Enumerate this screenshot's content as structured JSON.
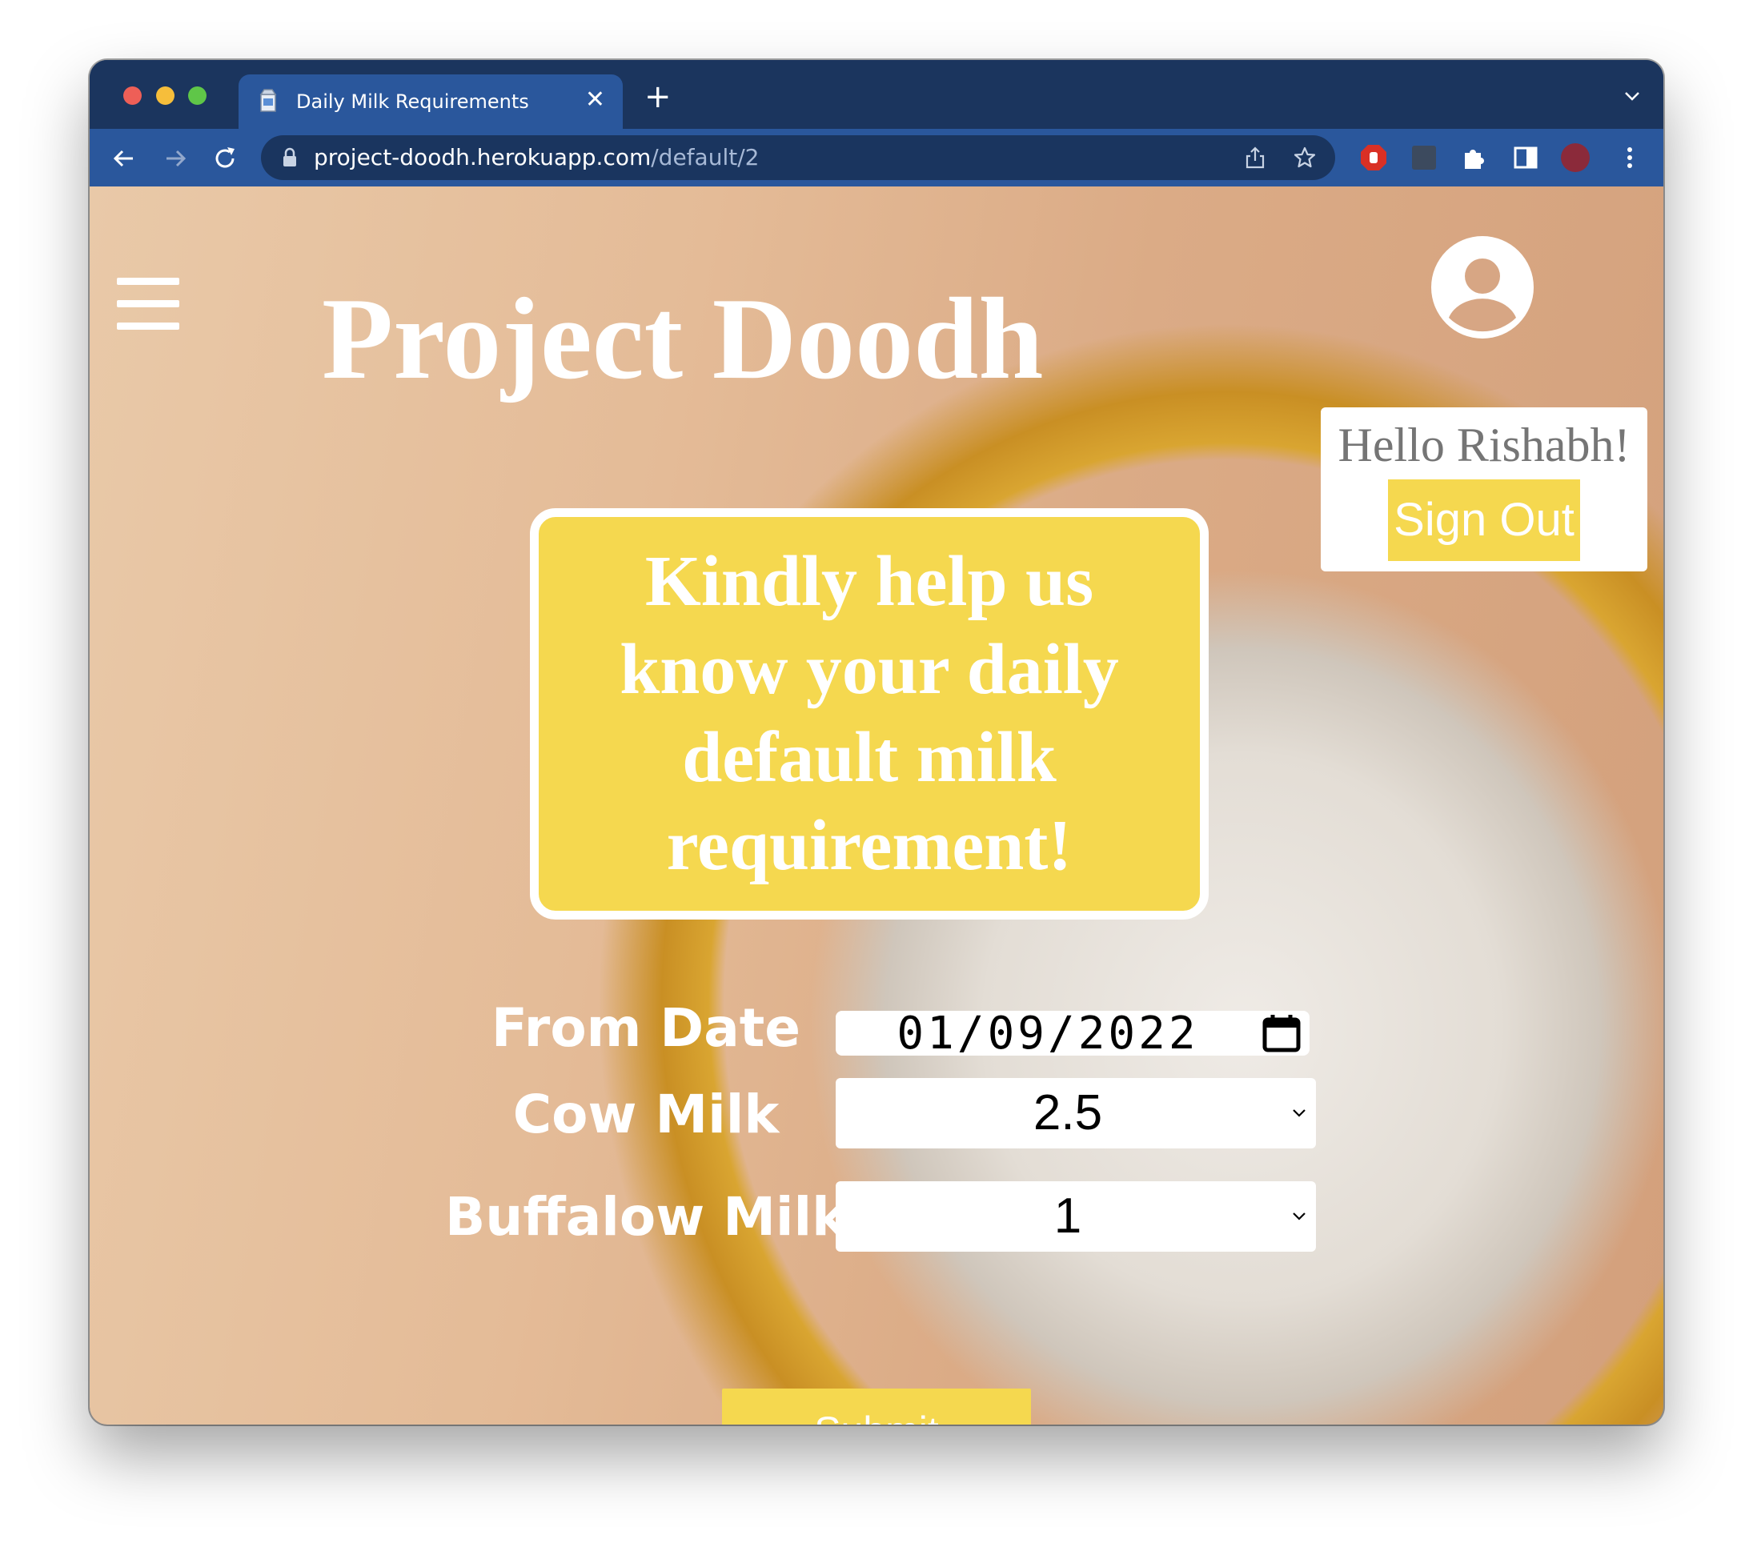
{
  "browser": {
    "tab_title": "Daily Milk Requirements",
    "tab_close": "✕",
    "new_tab": "+",
    "url_host": "project-doodh.herokuapp.com",
    "url_path": "/default/2"
  },
  "header": {
    "title": "Project Doodh",
    "greeting": "Hello Rishabh!",
    "signout_label": "Sign Out"
  },
  "banner": {
    "text": "Kindly help us know your daily default milk requirement!"
  },
  "form": {
    "from_date_label": "From Date",
    "from_date_value": "01/09/2022",
    "cow_milk_label": "Cow Milk",
    "cow_milk_value": "2.5",
    "buffalow_milk_label": "Buffalow Milk",
    "buffalow_milk_value": "1",
    "submit_label": "Submit"
  },
  "colors": {
    "accent_yellow": "#f5d84f",
    "browser_frame": "#1b355e",
    "toolbar": "#2a579c"
  }
}
